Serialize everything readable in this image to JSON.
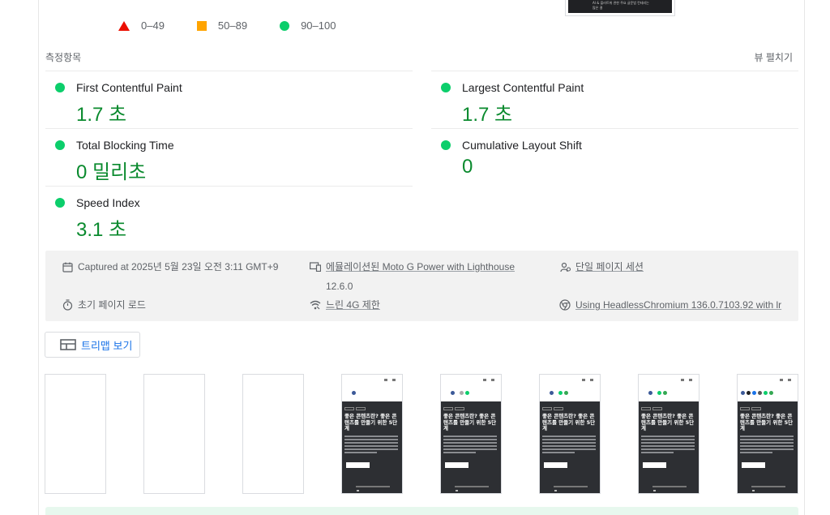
{
  "legend": {
    "fail": "0–49",
    "average": "50–89",
    "pass": "90–100"
  },
  "thumbnail_caption": "AI & 플러트위 관한 주요 글문법 컨테리는 많은 결",
  "metrics_section": {
    "title": "측정항목",
    "expand_label": "뷰 펼치기",
    "items": [
      {
        "title": "First Contentful Paint",
        "value": "1.7 초"
      },
      {
        "title": "Largest Contentful Paint",
        "value": "1.7 초"
      },
      {
        "title": "Total Blocking Time",
        "value": "0 밀리초"
      },
      {
        "title": "Cumulative Layout Shift",
        "value": "0"
      },
      {
        "title": "Speed Index",
        "value": "3.1 초"
      }
    ],
    "status_color": "#0cce6b",
    "value_color": "#0a8a2e"
  },
  "runtime": {
    "captured": "Captured at 2025년 5월 23일 오전 3:11 GMT+9",
    "device_line1": "에뮬레이션된 Moto G Power with Lighthouse",
    "device_line2": "12.6.0",
    "session": "단일 페이지 세션",
    "load": "초기 페이지 로드",
    "throttling": "느린 4G 제한",
    "browser": "Using HeadlessChromium 136.0.7103.92 with lr"
  },
  "treemap_button": {
    "label": "트리맵 보기"
  },
  "filmstrip": {
    "headline": "좋은 콘텐츠란? 좋은 콘텐츠를 만들기 위한 5단계"
  }
}
